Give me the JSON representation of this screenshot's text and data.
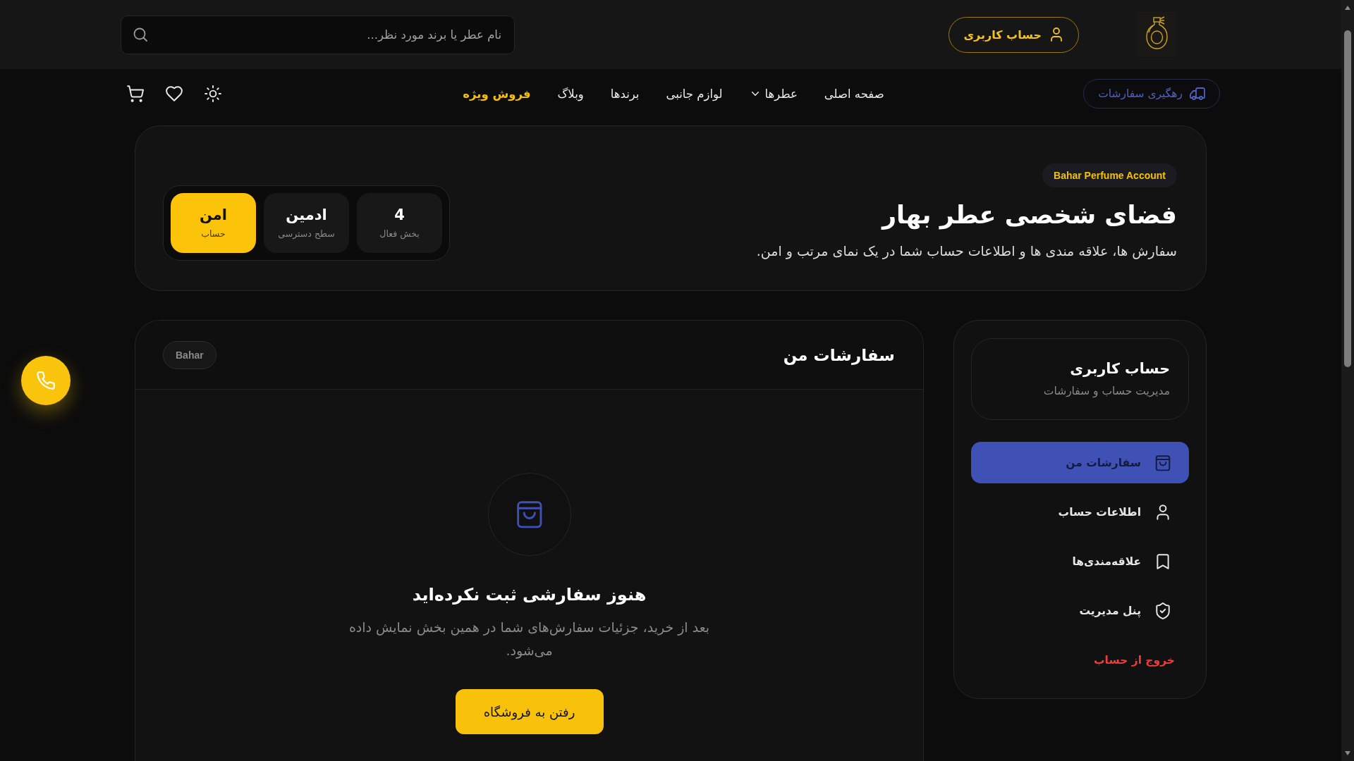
{
  "header": {
    "account_button": {
      "label": "حساب کاربری"
    },
    "search": {
      "placeholder": "نام عطر یا برند مورد نظر..."
    }
  },
  "nav": {
    "track_orders_button": {
      "label": "رهگیری سفارشات"
    },
    "links": [
      {
        "label": "صفحه اصلی",
        "dropdown": false,
        "highlighted": false
      },
      {
        "label": "عطرها",
        "dropdown": true,
        "highlighted": false
      },
      {
        "label": "لوازم جانبی",
        "dropdown": false,
        "highlighted": false
      },
      {
        "label": "برندها",
        "dropdown": false,
        "highlighted": false
      },
      {
        "label": "وبلاگ",
        "dropdown": false,
        "highlighted": false
      },
      {
        "label": "فروش ویژه",
        "dropdown": false,
        "highlighted": true
      }
    ]
  },
  "hero": {
    "badge": "Bahar Perfume Account",
    "title": "فضای شخصی عطر بهار",
    "subtitle": "سفارش ها، علاقه مندی ها و اطلاعات حساب شما در یک نمای مرتب و امن.",
    "stats": [
      {
        "value": "4",
        "label": "بخش فعال",
        "highlighted": false
      },
      {
        "value": "ادمین",
        "label": "سطح دسترسی",
        "highlighted": false
      },
      {
        "value": "امن",
        "label": "حساب",
        "highlighted": true
      }
    ]
  },
  "sidebar": {
    "title": "حساب کاربری",
    "subtitle": "مدیریت حساب و سفارشات",
    "items": [
      {
        "label": "سفارشات من",
        "selected": true
      },
      {
        "label": "اطلاعات حساب",
        "selected": false
      },
      {
        "label": "علاقه‌مندی‌ها",
        "selected": false
      },
      {
        "label": "پنل مدیریت",
        "selected": false
      }
    ],
    "logout": {
      "label": "خروج از حساب"
    }
  },
  "orders": {
    "title": "سفارشات من",
    "badge": "Bahar",
    "empty_state": {
      "heading": "هنوز سفارشی ثبت نکرده‌اید",
      "message": "بعد از خرید، جزئیات سفارش‌های شما در همین بخش نمایش داده می‌شود.",
      "button": "رفتن به فروشگاه"
    }
  }
}
